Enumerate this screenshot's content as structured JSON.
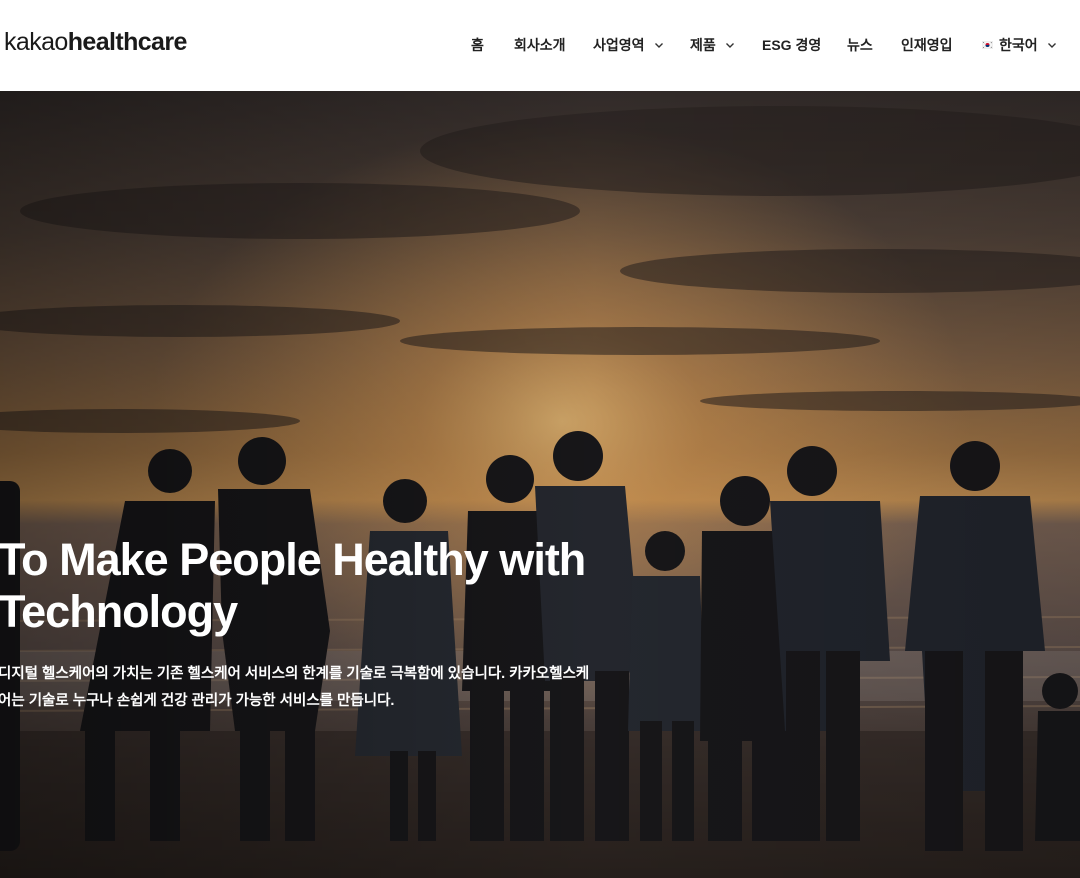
{
  "header": {
    "logo_light": "kakao",
    "logo_bold": "healthcare"
  },
  "nav": {
    "items": [
      {
        "label": "홈",
        "has_dropdown": false
      },
      {
        "label": "회사소개",
        "has_dropdown": false
      },
      {
        "label": "사업영역",
        "has_dropdown": true
      },
      {
        "label": "제품",
        "has_dropdown": true
      },
      {
        "label": "ESG 경영",
        "has_dropdown": false
      },
      {
        "label": "뉴스",
        "has_dropdown": false
      },
      {
        "label": "인재영입",
        "has_dropdown": false
      },
      {
        "label": "한국어",
        "has_dropdown": true,
        "icon": "korea-flag-icon"
      }
    ]
  },
  "hero": {
    "title_line1": "To Make People Healthy with",
    "title_line2": "Technology",
    "description_line1": "디지털 헬스케어의 가치는 기존 헬스케어 서비스의 한계를 기술로 극복함에 있습니다. 카카오헬스케",
    "description_line2": "어는 기술로 누구나 손쉽게 건강 관리가 가능한 서비스를 만듭니다.",
    "image_description_colors": {
      "sky_top": "#3a3230",
      "sunset_glow": "#e6a45a",
      "sea": "#8a7060",
      "silhouette": "#1b1a1d"
    }
  }
}
